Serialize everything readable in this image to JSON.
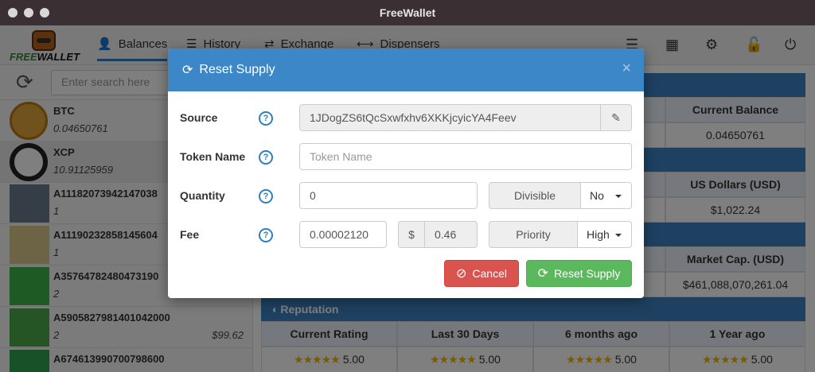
{
  "window": {
    "title": "FreeWallet"
  },
  "logo": {
    "free": "FREE",
    "wallet": "WALLET"
  },
  "nav": {
    "tabs": [
      {
        "label": "Balances",
        "icon": "user-icon"
      },
      {
        "label": "History",
        "icon": "list-icon"
      },
      {
        "label": "Exchange",
        "icon": "exchange-icon"
      },
      {
        "label": "Dispensers",
        "icon": "arrows-h-icon"
      }
    ],
    "right_icons": [
      "list-icon",
      "qrcode-icon",
      "gears-icon",
      "unlock-icon",
      "power-icon"
    ]
  },
  "sidebar": {
    "search_placeholder": "Enter search here",
    "assets": [
      {
        "name": "BTC",
        "balance": "0.04650761",
        "usd": ""
      },
      {
        "name": "XCP",
        "balance": "10.91125959",
        "usd": ""
      },
      {
        "name": "A11182073942147038",
        "balance": "1",
        "usd": ""
      },
      {
        "name": "A11190232858145604",
        "balance": "1",
        "usd": ""
      },
      {
        "name": "A35764782480473190",
        "balance": "2",
        "usd": ""
      },
      {
        "name": "A5905827981401042000",
        "balance": "2",
        "usd": "$99.62"
      },
      {
        "name": "A674613990700798600",
        "balance": "",
        "usd": ""
      }
    ]
  },
  "main": {
    "row1": {
      "head": "Current Balance",
      "value": "0.04650761"
    },
    "row2": {
      "head": "US Dollars (USD)",
      "value": "$1,022.24"
    },
    "row3": {
      "head": "Market Cap. (USD)",
      "value": "$461,088,070,261.04"
    },
    "reputation": {
      "title": "Reputation",
      "columns": [
        "Current Rating",
        "Last 30 Days",
        "6 months ago",
        "1 Year ago"
      ],
      "stars": "★★★★★",
      "values": [
        "5.00",
        "5.00",
        "5.00",
        "5.00"
      ]
    }
  },
  "modal": {
    "title": "Reset Supply",
    "close": "×",
    "source_label": "Source",
    "source_value": "1JDogZS6tQcSxwfxhv6XKKjcyicYA4Feev",
    "token_label": "Token Name",
    "token_placeholder": "Token Name",
    "quantity_label": "Quantity",
    "quantity_value": "0",
    "divisible_label": "Divisible",
    "divisible_value": "No",
    "fee_label": "Fee",
    "fee_value": "0.00002120",
    "usd_symbol": "$",
    "fee_usd": "0.46",
    "priority_label": "Priority",
    "priority_value": "High",
    "help": "?",
    "cancel_label": "Cancel",
    "submit_label": "Reset Supply"
  }
}
